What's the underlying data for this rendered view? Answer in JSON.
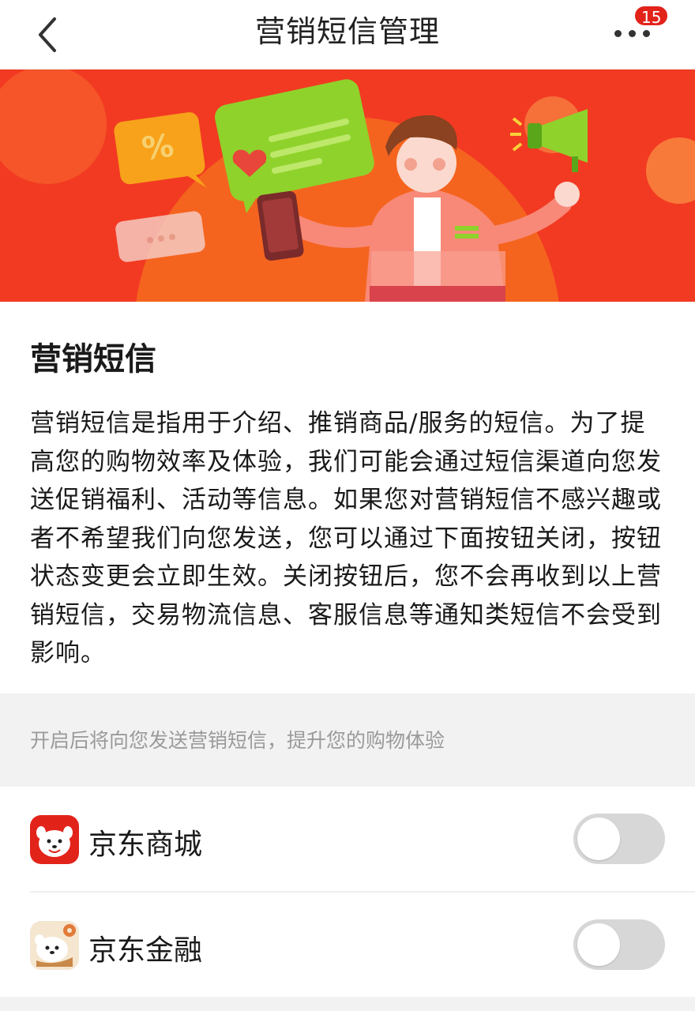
{
  "header": {
    "title": "营销短信管理",
    "badge_count": "15",
    "back_icon": "chevron-left-icon",
    "more_icon": "more-dots-icon"
  },
  "intro": {
    "title": "营销短信",
    "description": "营销短信是指用于介绍、推销商品/服务的短信。为了提高您的购物效率及体验，我们可能会通过短信渠道向您发送促销福利、活动等信息。如果您对营销短信不感兴趣或者不希望我们向您发送，您可以通过下面按钮关闭，按钮状态变更会立即生效。关闭按钮后，您不会再收到以上营销短信，交易物流信息、客服信息等通知类短信不会受到影响。"
  },
  "hint": "开启后将向您发送营销短信，提升您的购物体验",
  "apps": [
    {
      "name": "京东商城",
      "enabled": false,
      "icon": "jd-mall-icon"
    },
    {
      "name": "京东金融",
      "enabled": false,
      "icon": "jd-finance-icon"
    }
  ],
  "colors": {
    "brand": "#e2231a",
    "banner_bg": "#f23a22",
    "toggle_off": "#d7d7d7",
    "hint_text": "#9a9a9a"
  }
}
